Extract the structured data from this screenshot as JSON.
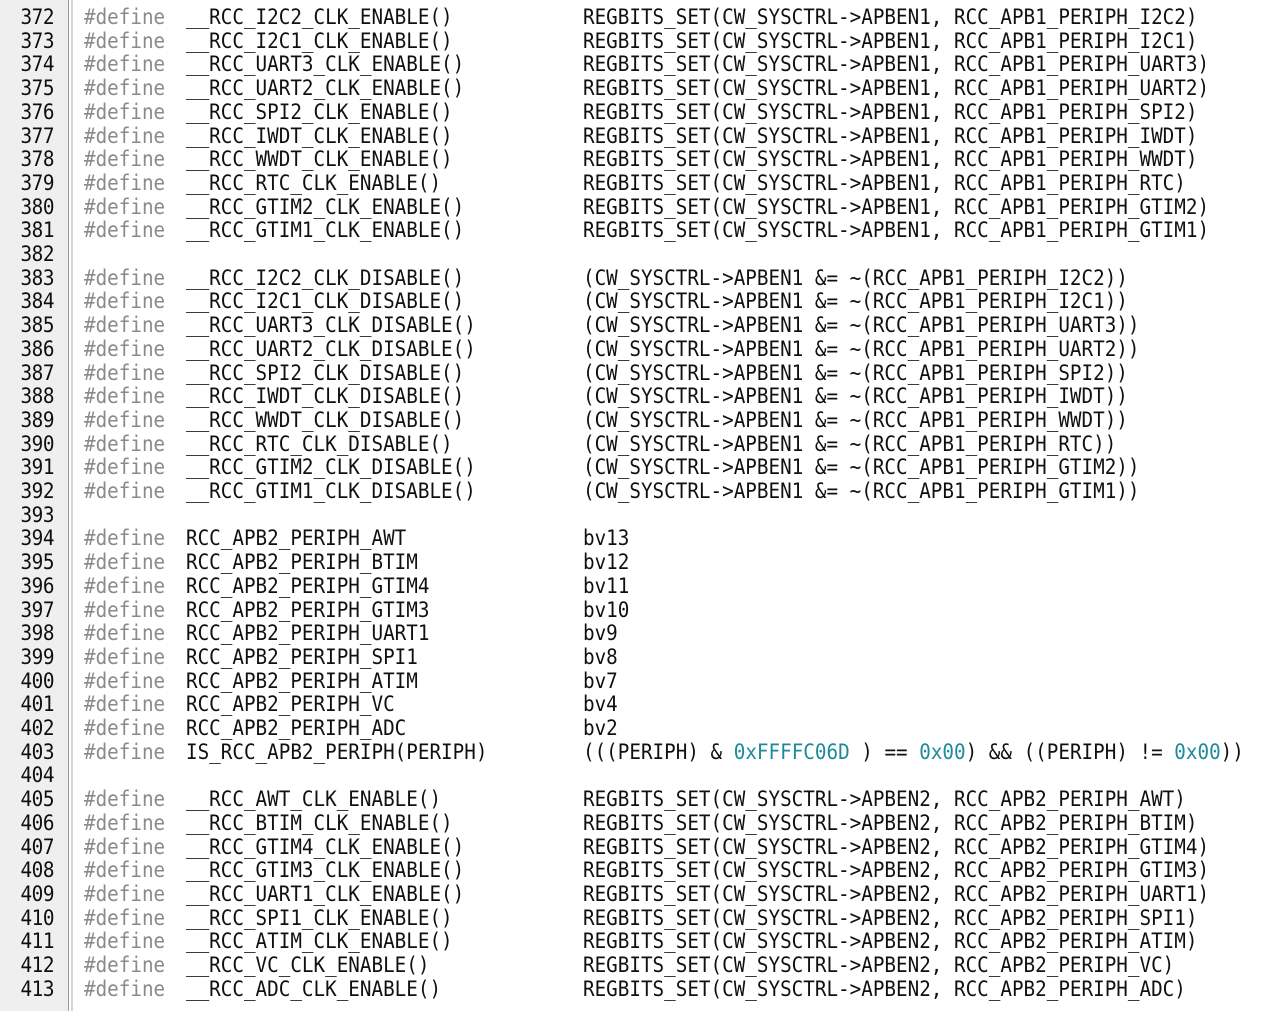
{
  "editor": {
    "lines": [
      {
        "num": "372",
        "define": "#define",
        "name": "__RCC_I2C2_CLK_ENABLE()",
        "value": "REGBITS_SET(CW_SYSCTRL->APBEN1, RCC_APB1_PERIPH_I2C2)"
      },
      {
        "num": "373",
        "define": "#define",
        "name": "__RCC_I2C1_CLK_ENABLE()",
        "value": "REGBITS_SET(CW_SYSCTRL->APBEN1, RCC_APB1_PERIPH_I2C1)"
      },
      {
        "num": "374",
        "define": "#define",
        "name": "__RCC_UART3_CLK_ENABLE()",
        "value": "REGBITS_SET(CW_SYSCTRL->APBEN1, RCC_APB1_PERIPH_UART3)"
      },
      {
        "num": "375",
        "define": "#define",
        "name": "__RCC_UART2_CLK_ENABLE()",
        "value": "REGBITS_SET(CW_SYSCTRL->APBEN1, RCC_APB1_PERIPH_UART2)"
      },
      {
        "num": "376",
        "define": "#define",
        "name": "__RCC_SPI2_CLK_ENABLE()",
        "value": "REGBITS_SET(CW_SYSCTRL->APBEN1, RCC_APB1_PERIPH_SPI2)"
      },
      {
        "num": "377",
        "define": "#define",
        "name": "__RCC_IWDT_CLK_ENABLE()",
        "value": "REGBITS_SET(CW_SYSCTRL->APBEN1, RCC_APB1_PERIPH_IWDT)"
      },
      {
        "num": "378",
        "define": "#define",
        "name": "__RCC_WWDT_CLK_ENABLE()",
        "value": "REGBITS_SET(CW_SYSCTRL->APBEN1, RCC_APB1_PERIPH_WWDT)"
      },
      {
        "num": "379",
        "define": "#define",
        "name": "__RCC_RTC_CLK_ENABLE()",
        "value": "REGBITS_SET(CW_SYSCTRL->APBEN1, RCC_APB1_PERIPH_RTC)"
      },
      {
        "num": "380",
        "define": "#define",
        "name": "__RCC_GTIM2_CLK_ENABLE()",
        "value": "REGBITS_SET(CW_SYSCTRL->APBEN1, RCC_APB1_PERIPH_GTIM2)"
      },
      {
        "num": "381",
        "define": "#define",
        "name": "__RCC_GTIM1_CLK_ENABLE()",
        "value": "REGBITS_SET(CW_SYSCTRL->APBEN1, RCC_APB1_PERIPH_GTIM1)"
      },
      {
        "num": "382"
      },
      {
        "num": "383",
        "define": "#define",
        "name": "__RCC_I2C2_CLK_DISABLE()",
        "value": "(CW_SYSCTRL->APBEN1 &= ~(RCC_APB1_PERIPH_I2C2))"
      },
      {
        "num": "384",
        "define": "#define",
        "name": "__RCC_I2C1_CLK_DISABLE()",
        "value": "(CW_SYSCTRL->APBEN1 &= ~(RCC_APB1_PERIPH_I2C1))"
      },
      {
        "num": "385",
        "define": "#define",
        "name": "__RCC_UART3_CLK_DISABLE()",
        "value": "(CW_SYSCTRL->APBEN1 &= ~(RCC_APB1_PERIPH_UART3))"
      },
      {
        "num": "386",
        "define": "#define",
        "name": "__RCC_UART2_CLK_DISABLE()",
        "value": "(CW_SYSCTRL->APBEN1 &= ~(RCC_APB1_PERIPH_UART2))"
      },
      {
        "num": "387",
        "define": "#define",
        "name": "__RCC_SPI2_CLK_DISABLE()",
        "value": "(CW_SYSCTRL->APBEN1 &= ~(RCC_APB1_PERIPH_SPI2))"
      },
      {
        "num": "388",
        "define": "#define",
        "name": "__RCC_IWDT_CLK_DISABLE()",
        "value": "(CW_SYSCTRL->APBEN1 &= ~(RCC_APB1_PERIPH_IWDT))"
      },
      {
        "num": "389",
        "define": "#define",
        "name": "__RCC_WWDT_CLK_DISABLE()",
        "value": "(CW_SYSCTRL->APBEN1 &= ~(RCC_APB1_PERIPH_WWDT))"
      },
      {
        "num": "390",
        "define": "#define",
        "name": "__RCC_RTC_CLK_DISABLE()",
        "value": "(CW_SYSCTRL->APBEN1 &= ~(RCC_APB1_PERIPH_RTC))"
      },
      {
        "num": "391",
        "define": "#define",
        "name": "__RCC_GTIM2_CLK_DISABLE()",
        "value": "(CW_SYSCTRL->APBEN1 &= ~(RCC_APB1_PERIPH_GTIM2))"
      },
      {
        "num": "392",
        "define": "#define",
        "name": "__RCC_GTIM1_CLK_DISABLE()",
        "value": "(CW_SYSCTRL->APBEN1 &= ~(RCC_APB1_PERIPH_GTIM1))"
      },
      {
        "num": "393"
      },
      {
        "num": "394",
        "define": "#define",
        "name": "RCC_APB2_PERIPH_AWT",
        "value": "bv13"
      },
      {
        "num": "395",
        "define": "#define",
        "name": "RCC_APB2_PERIPH_BTIM",
        "value": "bv12"
      },
      {
        "num": "396",
        "define": "#define",
        "name": "RCC_APB2_PERIPH_GTIM4",
        "value": "bv11"
      },
      {
        "num": "397",
        "define": "#define",
        "name": "RCC_APB2_PERIPH_GTIM3",
        "value": "bv10"
      },
      {
        "num": "398",
        "define": "#define",
        "name": "RCC_APB2_PERIPH_UART1",
        "value": "bv9"
      },
      {
        "num": "399",
        "define": "#define",
        "name": "RCC_APB2_PERIPH_SPI1",
        "value": "bv8"
      },
      {
        "num": "400",
        "define": "#define",
        "name": "RCC_APB2_PERIPH_ATIM",
        "value": "bv7"
      },
      {
        "num": "401",
        "define": "#define",
        "name": "RCC_APB2_PERIPH_VC",
        "value": "bv4"
      },
      {
        "num": "402",
        "define": "#define",
        "name": "RCC_APB2_PERIPH_ADC",
        "value": "bv2"
      },
      {
        "num": "403",
        "define": "#define",
        "name": "IS_RCC_APB2_PERIPH(PERIPH)",
        "value": "(((PERIPH) & 0xFFFFC06D ) == 0x00) && ((PERIPH) != 0x00))"
      },
      {
        "num": "404"
      },
      {
        "num": "405",
        "define": "#define",
        "name": "__RCC_AWT_CLK_ENABLE()",
        "value": "REGBITS_SET(CW_SYSCTRL->APBEN2, RCC_APB2_PERIPH_AWT)"
      },
      {
        "num": "406",
        "define": "#define",
        "name": "__RCC_BTIM_CLK_ENABLE()",
        "value": "REGBITS_SET(CW_SYSCTRL->APBEN2, RCC_APB2_PERIPH_BTIM)"
      },
      {
        "num": "407",
        "define": "#define",
        "name": "__RCC_GTIM4_CLK_ENABLE()",
        "value": "REGBITS_SET(CW_SYSCTRL->APBEN2, RCC_APB2_PERIPH_GTIM4)"
      },
      {
        "num": "408",
        "define": "#define",
        "name": "__RCC_GTIM3_CLK_ENABLE()",
        "value": "REGBITS_SET(CW_SYSCTRL->APBEN2, RCC_APB2_PERIPH_GTIM3)"
      },
      {
        "num": "409",
        "define": "#define",
        "name": "__RCC_UART1_CLK_ENABLE()",
        "value": "REGBITS_SET(CW_SYSCTRL->APBEN2, RCC_APB2_PERIPH_UART1)"
      },
      {
        "num": "410",
        "define": "#define",
        "name": "__RCC_SPI1_CLK_ENABLE()",
        "value": "REGBITS_SET(CW_SYSCTRL->APBEN2, RCC_APB2_PERIPH_SPI1)"
      },
      {
        "num": "411",
        "define": "#define",
        "name": "__RCC_ATIM_CLK_ENABLE()",
        "value": "REGBITS_SET(CW_SYSCTRL->APBEN2, RCC_APB2_PERIPH_ATIM)"
      },
      {
        "num": "412",
        "define": "#define",
        "name": "__RCC_VC_CLK_ENABLE()",
        "value": "REGBITS_SET(CW_SYSCTRL->APBEN2, RCC_APB2_PERIPH_VC)"
      },
      {
        "num": "413",
        "define": "#define",
        "name": "__RCC_ADC_CLK_ENABLE()",
        "value": "REGBITS_SET(CW_SYSCTRL->APBEN2, RCC_APB2_PERIPH_ADC)"
      }
    ]
  },
  "colors": {
    "keyword": "#8a8a8a",
    "number": "#1b8b99",
    "text": "#101010",
    "gutter": "#efefef"
  }
}
